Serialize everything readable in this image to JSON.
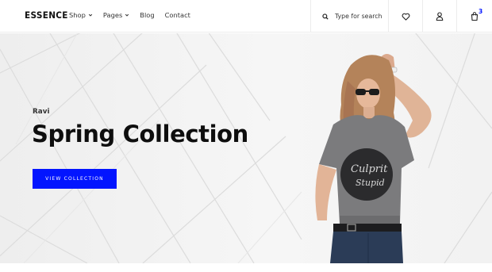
{
  "brand": {
    "logo": "ESSENCE"
  },
  "nav": {
    "items": [
      {
        "label": "Shop",
        "has_dropdown": true
      },
      {
        "label": "Pages",
        "has_dropdown": true
      },
      {
        "label": "Blog",
        "has_dropdown": false
      },
      {
        "label": "Contact",
        "has_dropdown": false
      }
    ]
  },
  "search": {
    "placeholder": "Type for search",
    "icon": "search-icon"
  },
  "header_icons": {
    "wishlist": "heart-icon",
    "account": "user-icon",
    "cart": "shopping-bag-icon",
    "cart_count": "3"
  },
  "hero": {
    "tagline": "Ravi",
    "headline": "Spring Collection",
    "cta_label": "VIEW COLLECTION",
    "shirt_print": "Culprit\nStupid"
  },
  "colors": {
    "accent": "#0315ff",
    "headline": "#0e0e0e",
    "hero_background": "#f3f3f3"
  }
}
